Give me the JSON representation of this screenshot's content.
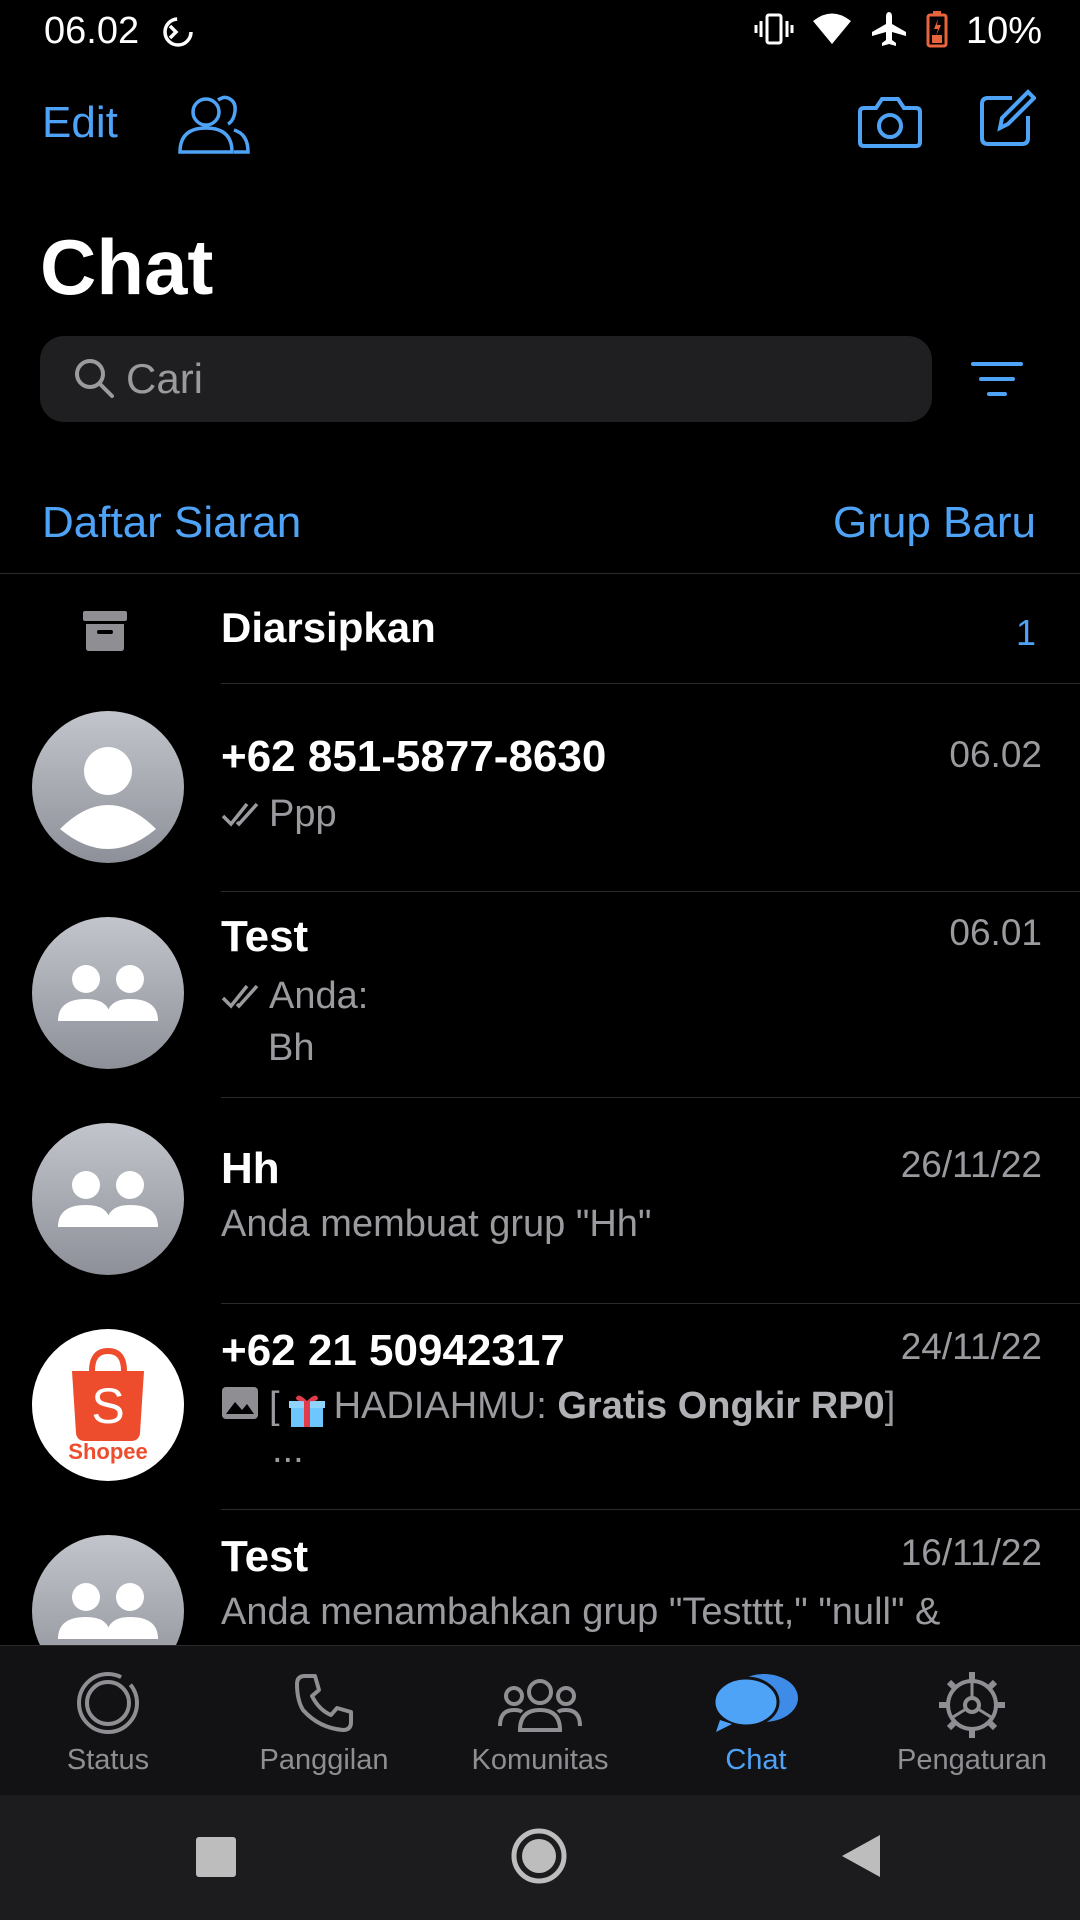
{
  "status_bar": {
    "time": "06.02",
    "battery": "10%",
    "icons": [
      "sync-icon",
      "vibrate-icon",
      "wifi-icon",
      "airplane-icon",
      "battery-icon"
    ]
  },
  "header": {
    "edit_label": "Edit",
    "title": "Chat",
    "icons": [
      "communities-icon",
      "camera-icon",
      "compose-icon"
    ]
  },
  "search": {
    "placeholder": "Cari"
  },
  "links": {
    "broadcast": "Daftar Siaran",
    "new_group": "Grup Baru"
  },
  "archived": {
    "label": "Diarsipkan",
    "count": "1"
  },
  "chats": [
    {
      "name": "+62 851-5877-8630",
      "time": "06.02",
      "preview": "Ppp",
      "read_ticks": true,
      "avatar": "person"
    },
    {
      "name": "Test",
      "time": "06.01",
      "preview_line1": "Anda:",
      "preview_line2": "Bh",
      "read_ticks": true,
      "avatar": "group"
    },
    {
      "name": "Hh",
      "time": "26/11/22",
      "preview": "Anda membuat grup \"Hh\"",
      "avatar": "group"
    },
    {
      "name": "+62 21 50942317",
      "time": "24/11/22",
      "preview_prefix": "[",
      "preview_mid": "HADIAHMU: ",
      "preview_bold": "Gratis Ongkir RP0",
      "preview_suffix": "]",
      "preview_line2": "...",
      "avatar": "shopee",
      "avatar_text": "Shopee",
      "avatar_letter": "S"
    },
    {
      "name": "Test",
      "time": "16/11/22",
      "preview": "Anda menambahkan grup \"Testttt,\" \"null\" &",
      "avatar": "group"
    }
  ],
  "tabs": [
    {
      "label": "Status",
      "icon": "status-icon",
      "active": false
    },
    {
      "label": "Panggilan",
      "icon": "phone-icon",
      "active": false
    },
    {
      "label": "Komunitas",
      "icon": "communities-icon",
      "active": false
    },
    {
      "label": "Chat",
      "icon": "chat-bubbles-icon",
      "active": true
    },
    {
      "label": "Pengaturan",
      "icon": "settings-icon",
      "active": false
    }
  ],
  "colors": {
    "accent": "#4fa3f7",
    "background": "#000000",
    "secondary_text": "#9a9a9f",
    "battery_low": "#e8643c",
    "shopee": "#ee4d2d"
  }
}
